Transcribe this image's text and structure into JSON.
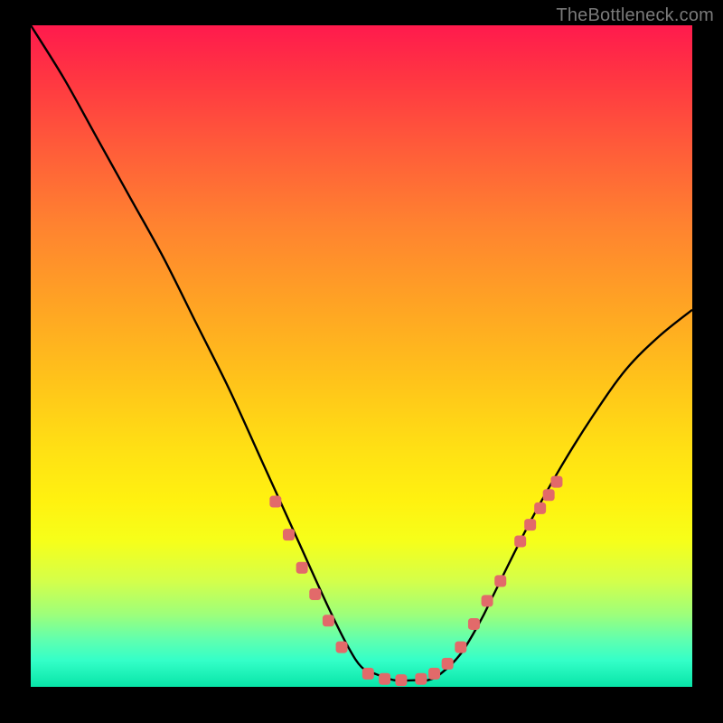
{
  "watermark": "TheBottleneck.com",
  "chart_data": {
    "type": "line",
    "title": "",
    "xlabel": "",
    "ylabel": "",
    "xlim": [
      0,
      100
    ],
    "ylim": [
      0,
      100
    ],
    "series": [
      {
        "name": "bottleneck-curve",
        "x": [
          0,
          5,
          10,
          15,
          20,
          25,
          30,
          35,
          40,
          45,
          48,
          50,
          52,
          55,
          58,
          60,
          62,
          65,
          68,
          70,
          75,
          80,
          85,
          90,
          95,
          100
        ],
        "values": [
          100,
          92,
          83,
          74,
          65,
          55,
          45,
          34,
          23,
          12,
          6,
          3,
          2,
          1,
          1,
          1,
          2,
          5,
          10,
          14,
          24,
          33,
          41,
          48,
          53,
          57
        ]
      }
    ],
    "markers": {
      "name": "highlight-dots",
      "x": [
        37,
        39,
        41,
        43,
        45,
        47,
        51,
        53.5,
        56,
        59,
        61,
        63,
        65,
        67,
        69,
        71,
        74,
        75.5,
        77,
        78.3,
        79.5
      ],
      "y": [
        28,
        23,
        18,
        14,
        10,
        6,
        2,
        1.2,
        1,
        1.2,
        2,
        3.5,
        6,
        9.5,
        13,
        16,
        22,
        24.5,
        27,
        29,
        31
      ]
    },
    "colors": {
      "curve": "#000000",
      "marker": "#e26a6a"
    }
  }
}
